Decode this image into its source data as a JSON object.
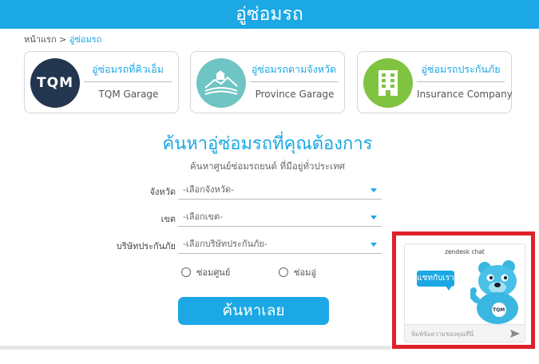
{
  "header": {
    "title": "อู่ซ่อมรถ"
  },
  "breadcrumb": {
    "home": "หน้าแรก",
    "sep": ">",
    "current": "อู่ซ่อมรถ"
  },
  "cards": [
    {
      "title": "อู่ซ่อมรถที่คิวเอ็ม",
      "subtitle": "TQM Garage",
      "logo_text": "TQM",
      "color": "#23364f"
    },
    {
      "title": "อู่ซ่อมรถตามจังหวัด",
      "subtitle": "Province Garage",
      "icon": "landscape-icon",
      "color": "#6fc5c3"
    },
    {
      "title": "อู่ซ่อมรถประกันภัย",
      "subtitle": "Insurance Company",
      "icon": "building-icon",
      "color": "#80c341"
    }
  ],
  "search": {
    "heading": "ค้นหาอู่ซ่อมรถที่คุณต้องการ",
    "subheading": "ค้นหาศูนย์ซ่อมรถยนต์ ที่มีอยู่ทั่วประเทศ",
    "fields": [
      {
        "label": "จังหวัด",
        "value": "-เลือกจังหวัด-"
      },
      {
        "label": "เขต",
        "value": "-เลือกเขต-"
      },
      {
        "label": "บริษัทประกันภัย",
        "value": "-เลือกบริษัทประกันภัย-"
      }
    ],
    "radio_options": [
      "ซ่อมศูนย์",
      "ซ่อมอู่"
    ],
    "button_label": "ค้นหาเลย"
  },
  "chat": {
    "brand": "zendesk chat",
    "bubble": "แชทกับเรา",
    "mascot_badge": "TQM",
    "input_placeholder": "พิมพ์ข้อความของคุณที่นี่",
    "highlight_color": "#e0202a"
  }
}
